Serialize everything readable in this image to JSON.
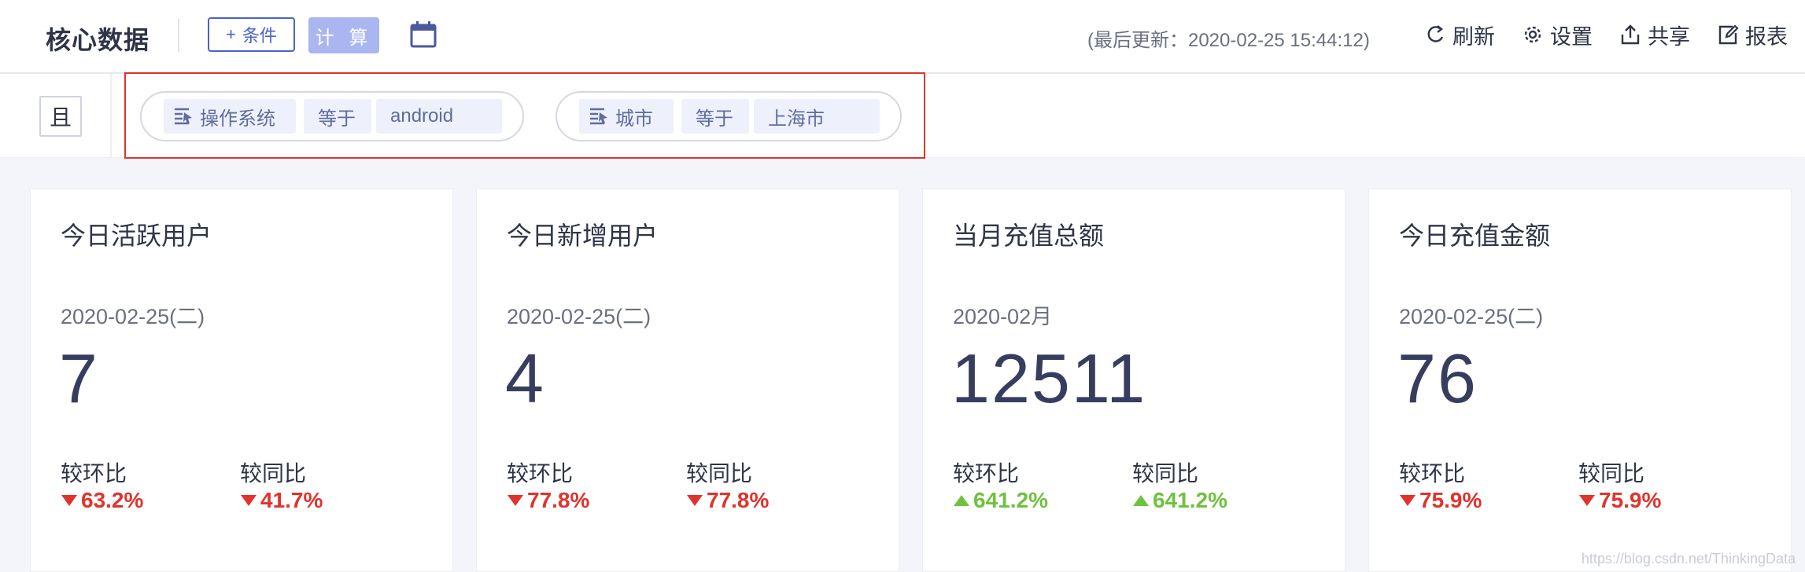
{
  "header": {
    "title": "核心数据",
    "add_condition": {
      "icon": "+",
      "label": "条件"
    },
    "compute_label": "计 算",
    "last_update": "(最后更新：2020-02-25 15:44:12)",
    "actions": {
      "refresh": "刷新",
      "settings": "设置",
      "share": "共享",
      "report": "报表"
    }
  },
  "filter": {
    "logic": "且",
    "conditions": [
      {
        "field": "操作系统",
        "operator": "等于",
        "value": "android"
      },
      {
        "field": "城市",
        "operator": "等于",
        "value": "上海市"
      }
    ]
  },
  "cards": [
    {
      "title": "今日活跃用户",
      "date": "2020-02-25(二)",
      "value": "7",
      "mom_label": "较环比",
      "mom": "63.2%",
      "mom_dir": "down",
      "yoy_label": "较同比",
      "yoy": "41.7%",
      "yoy_dir": "down"
    },
    {
      "title": "今日新增用户",
      "date": "2020-02-25(二)",
      "value": "4",
      "mom_label": "较环比",
      "mom": "77.8%",
      "mom_dir": "down",
      "yoy_label": "较同比",
      "yoy": "77.8%",
      "yoy_dir": "down"
    },
    {
      "title": "当月充值总额",
      "date": "2020-02月",
      "value": "12511",
      "mom_label": "较环比",
      "mom": "641.2%",
      "mom_dir": "up",
      "yoy_label": "较同比",
      "yoy": "641.2%",
      "yoy_dir": "up"
    },
    {
      "title": "今日充值金额",
      "date": "2020-02-25(二)",
      "value": "76",
      "mom_label": "较环比",
      "mom": "75.9%",
      "mom_dir": "down",
      "yoy_label": "较同比",
      "yoy": "75.9%",
      "yoy_dir": "down"
    }
  ],
  "colors": {
    "accent": "#4a63c8",
    "down": "#e0332d",
    "up": "#6fc13e",
    "highlight": "#e0332d"
  },
  "watermark": "https://blog.csdn.net/ThinkingData"
}
